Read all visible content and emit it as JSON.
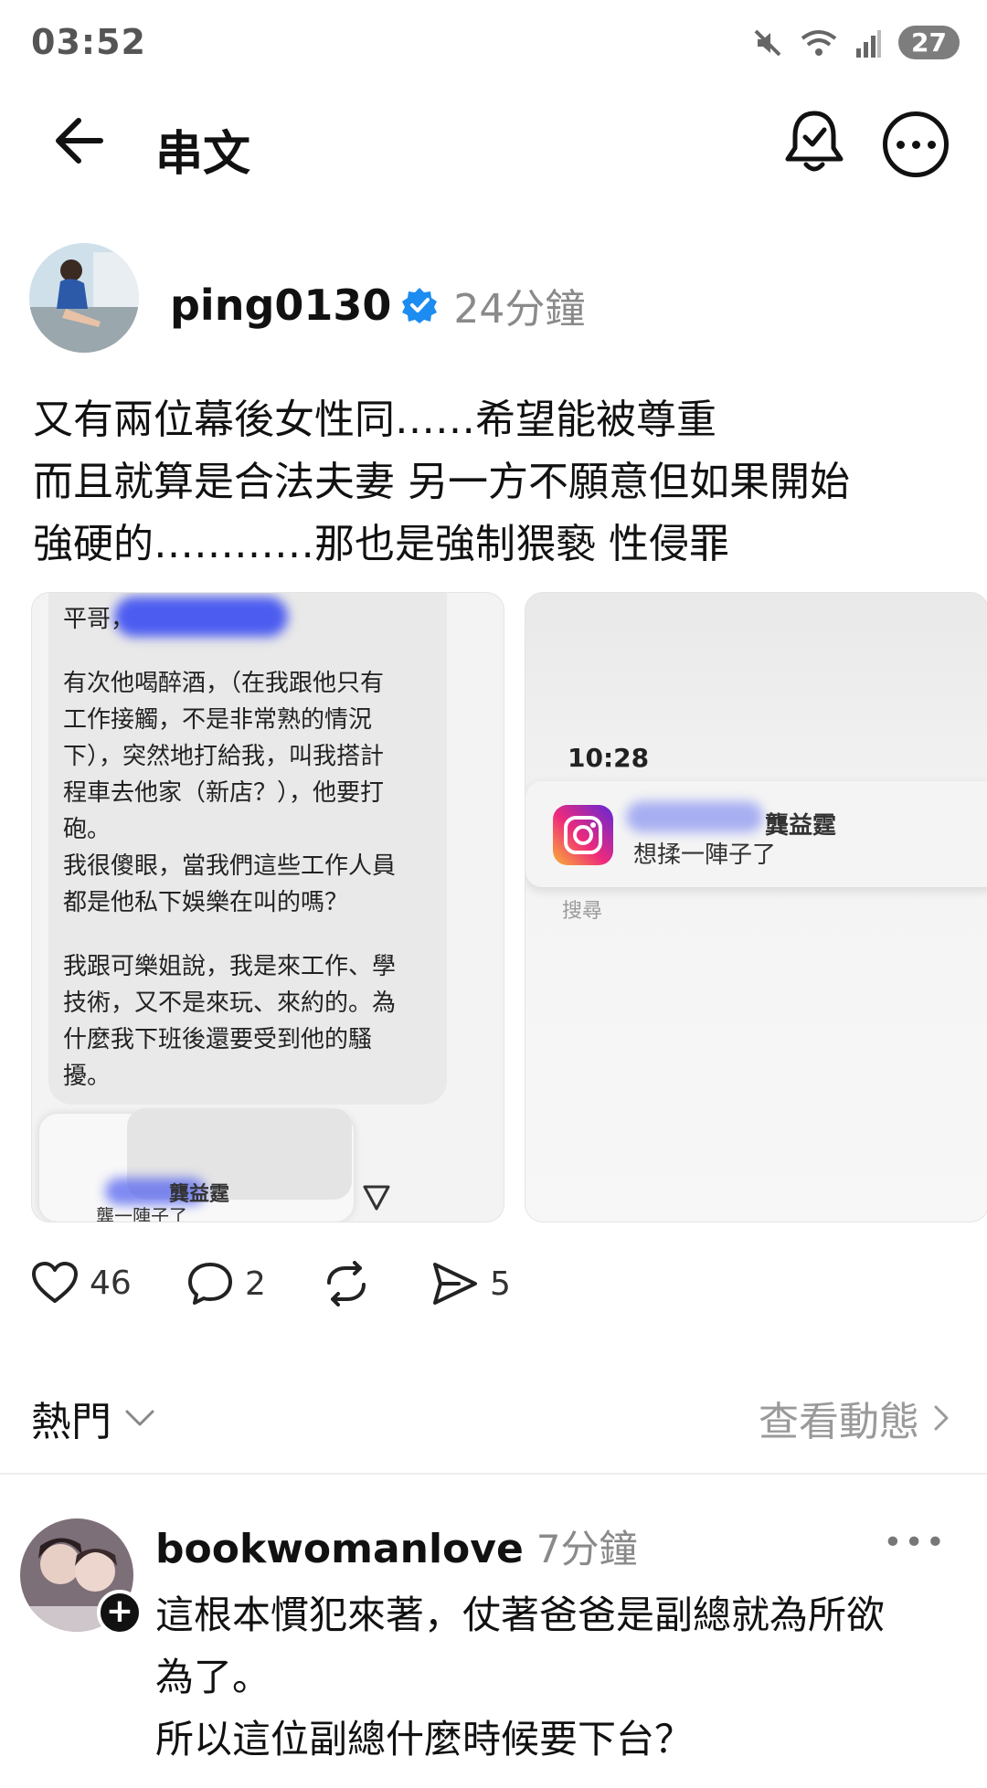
{
  "status_bar": {
    "time": "03:52",
    "battery": "27",
    "icons": [
      "mute-icon",
      "wifi-icon",
      "signal-icon",
      "battery-icon"
    ]
  },
  "header": {
    "title": "串文",
    "back_icon": "arrow-left-icon",
    "bell_icon": "bell-check-icon",
    "more_icon": "more-circle-icon"
  },
  "post": {
    "author": "ping0130",
    "verified": true,
    "time": "24分鐘",
    "text_lines": [
      "又有兩位幕後女性同……希望能被尊重",
      "而且就算是合法夫妻 另一方不願意但如果開始",
      "強硬的…………那也是強制猥褻 性侵罪"
    ],
    "image_left": {
      "lines": [
        "平哥，",
        "有次他喝醉酒，（在我跟他只有",
        "工作接觸，不是非常熟的情況",
        "下），突然地打給我，叫我搭計",
        "程車去他家（新店？），他要打",
        "砲。",
        "我很傻眼，當我們這些工作人員",
        "都是他私下娛樂在叫的嗎？",
        "我跟可樂姐說，我是來工作、學",
        "技術，又不是來玩、來約的。為",
        "什麼我下班後還要受到他的騷",
        "擾。"
      ],
      "card_name": "龔益霆",
      "card_msg": "龔一陣子了"
    },
    "image_right": {
      "time": "10:28",
      "notif_name": "龔益霆",
      "notif_msg": "想揉一陣子了",
      "search": "搜尋"
    },
    "actions": {
      "likes": "46",
      "comments": "2",
      "shares": "5"
    }
  },
  "sort": {
    "label": "熱門",
    "view_activity": "查看動態"
  },
  "comment": {
    "author": "bookwomanlove",
    "time": "7分鐘",
    "text_lines": [
      "這根本慣犯來著，仗著爸爸是副總就為所欲",
      "為了。",
      "所以這位副總什麼時候要下台？"
    ]
  }
}
